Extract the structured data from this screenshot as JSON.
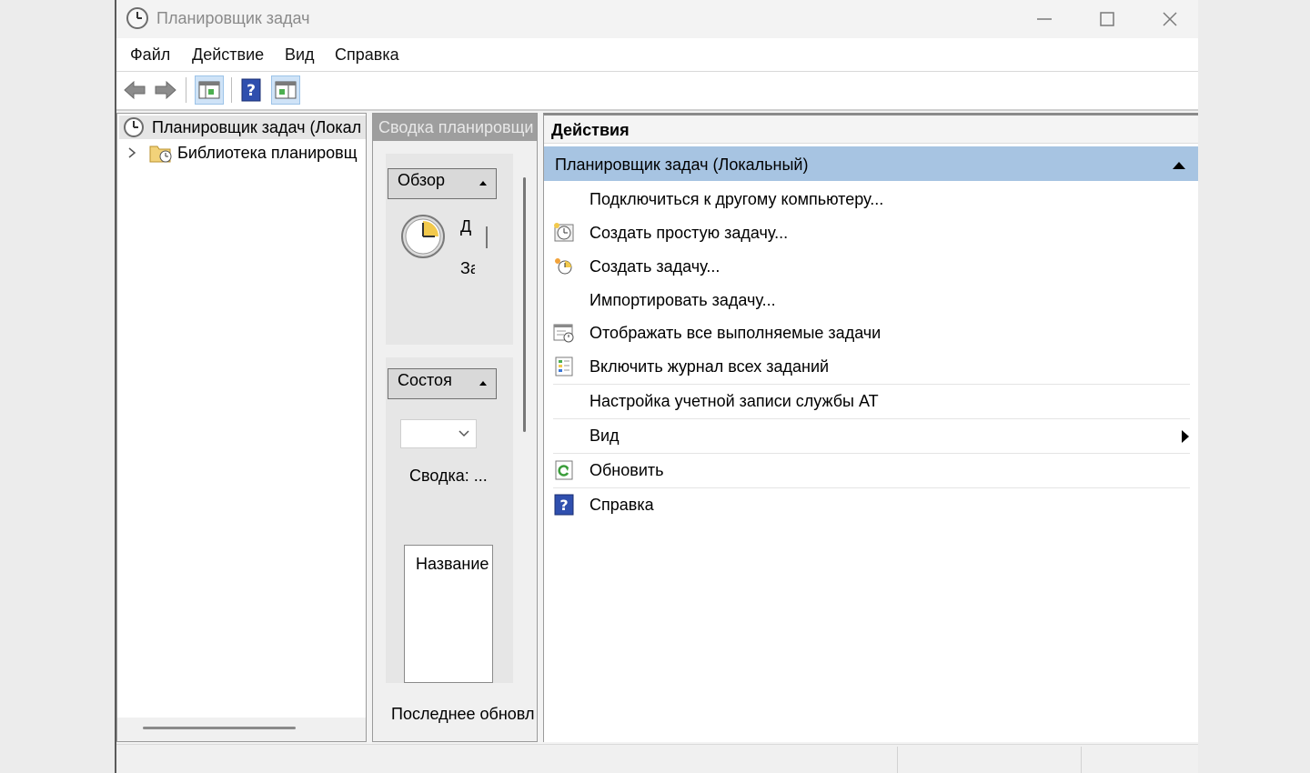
{
  "window": {
    "title": "Планировщик задач"
  },
  "menu": [
    "Файл",
    "Действие",
    "Вид",
    "Справка"
  ],
  "toolbar": {
    "icons": [
      "back-arrow-icon",
      "forward-arrow-icon",
      "show-hide-console-tree-icon",
      "help-icon",
      "show-hide-action-pane-icon"
    ]
  },
  "tree": {
    "root": "Планировщик задач (Локал",
    "child": "Библиотека планировщ"
  },
  "summary": {
    "header": "Сводка планировщи",
    "overview_title": "Обзор",
    "overview_line1": "Д",
    "overview_line2": "За",
    "status_title": "Состоя",
    "summary_label": "Сводка: ...",
    "name_column": "Название",
    "last_update": "Последнее обновл"
  },
  "actions": {
    "title": "Действия",
    "group": "Планировщик задач (Локальный)",
    "items": [
      {
        "label": "Подключиться к другому компьютеру...",
        "icon": ""
      },
      {
        "label": "Создать простую задачу...",
        "icon": "create-basic-task-icon"
      },
      {
        "label": "Создать задачу...",
        "icon": "create-task-icon"
      },
      {
        "label": "Импортировать задачу...",
        "icon": ""
      },
      {
        "label": "Отображать все выполняемые задачи",
        "icon": "running-tasks-icon"
      },
      {
        "label": "Включить журнал всех заданий",
        "icon": "history-log-icon"
      },
      {
        "label": "Настройка учетной записи службы AT",
        "icon": ""
      },
      {
        "label": "Вид",
        "icon": ""
      },
      {
        "label": "Обновить",
        "icon": "refresh-icon"
      },
      {
        "label": "Справка",
        "icon": "help-icon"
      }
    ]
  },
  "colors": {
    "accent_group": "#a7c4e2",
    "help_blue": "#2f4fae",
    "clock_yellow": "#f2c94c"
  }
}
